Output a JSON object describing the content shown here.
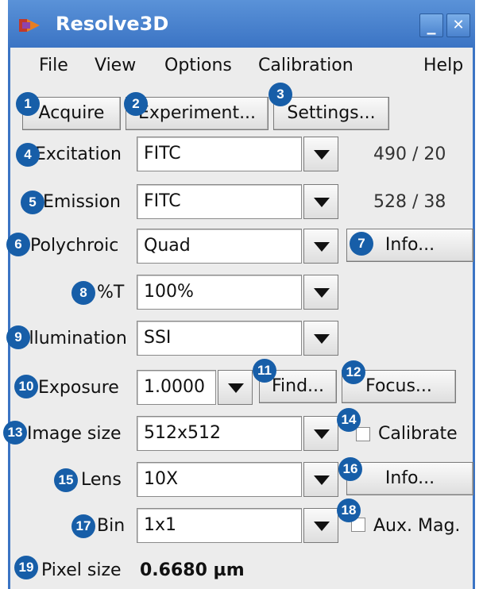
{
  "window": {
    "title": "Resolve3D",
    "minimize_label": "_",
    "close_label": "✕"
  },
  "menu": {
    "file": "File",
    "view": "View",
    "options": "Options",
    "calibration": "Calibration",
    "help": "Help"
  },
  "toolbar": {
    "acquire": "Acquire",
    "experiment": "Experiment...",
    "settings": "Settings..."
  },
  "fields": {
    "excitation": {
      "label": "Excitation",
      "value": "FITC",
      "readout": "490 / 20"
    },
    "emission": {
      "label": "Emission",
      "value": "FITC",
      "readout": "528 / 38"
    },
    "polychroic": {
      "label": "Polychroic",
      "value": "Quad",
      "info": "Info..."
    },
    "transmission": {
      "label": "%T",
      "value": "100%"
    },
    "illumination": {
      "label": "Illumination",
      "value": "SSI"
    },
    "exposure": {
      "label": "Exposure",
      "value": "1.0000",
      "find": "Find...",
      "focus": "Focus..."
    },
    "image_size": {
      "label": "Image size",
      "value": "512x512",
      "calibrate": "Calibrate"
    },
    "lens": {
      "label": "Lens",
      "value": "10X",
      "info": "Info..."
    },
    "bin": {
      "label": "Bin",
      "value": "1x1",
      "aux_mag": "Aux. Mag."
    },
    "pixel_size": {
      "label": "Pixel size",
      "value": "0.6680 µm"
    }
  },
  "badges": [
    "1",
    "2",
    "3",
    "4",
    "5",
    "6",
    "7",
    "8",
    "9",
    "10",
    "11",
    "12",
    "13",
    "14",
    "15",
    "16",
    "17",
    "18",
    "19"
  ],
  "colors": {
    "titlebar": "#3b74c4",
    "badge": "#175ea8",
    "window_bg": "#ececec"
  }
}
